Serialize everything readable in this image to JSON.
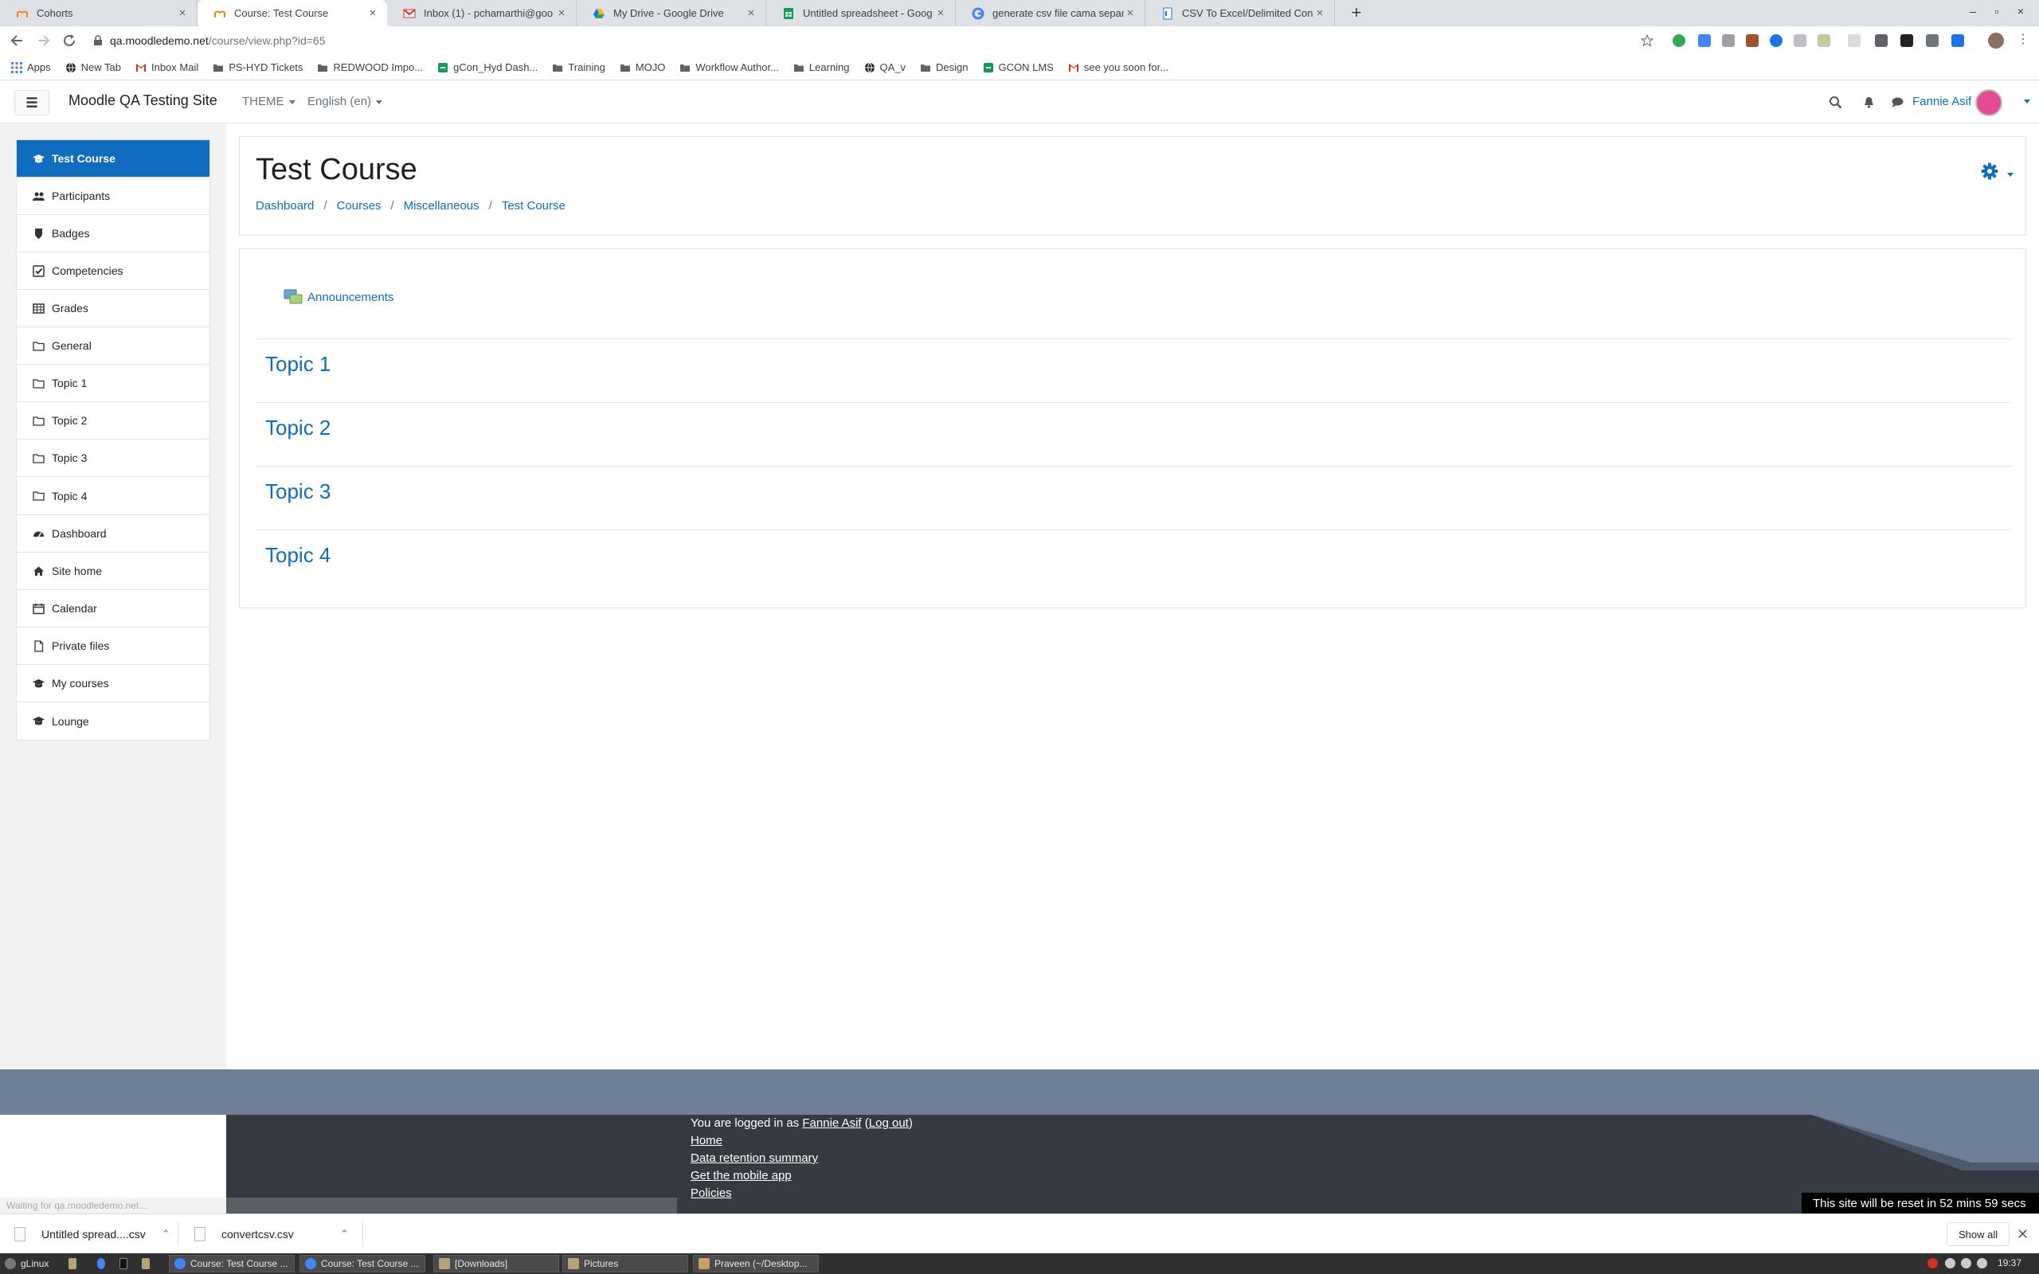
{
  "browser": {
    "tabs": [
      {
        "title": "Cohorts",
        "active": false
      },
      {
        "title": "Course: Test Course",
        "active": true
      },
      {
        "title": "Inbox (1) - pchamarthi@goo",
        "active": false
      },
      {
        "title": "My Drive - Google Drive",
        "active": false
      },
      {
        "title": "Untitled spreadsheet - Goog",
        "active": false
      },
      {
        "title": "generate csv file cama separ",
        "active": false
      },
      {
        "title": "CSV To Excel/Delimited Conv",
        "active": false
      }
    ],
    "new_tab_label": "+",
    "window_controls": [
      "–",
      "▫",
      "×"
    ],
    "url_host": "qa.moodledemo.net",
    "url_path": "/course/view.php?id=65"
  },
  "bookmarks": [
    {
      "label": "Apps",
      "icon": "apps-grid-icon"
    },
    {
      "label": "New Tab",
      "icon": "globe-icon"
    },
    {
      "label": "Inbox Mail",
      "icon": "gmail-icon"
    },
    {
      "label": "PS-HYD Tickets",
      "icon": "folder-icon"
    },
    {
      "label": "REDWOOD Impo...",
      "icon": "folder-icon"
    },
    {
      "label": "gCon_Hyd Dash...",
      "icon": "gcon-icon"
    },
    {
      "label": "Training",
      "icon": "folder-icon"
    },
    {
      "label": "MOJO",
      "icon": "folder-icon"
    },
    {
      "label": "Workflow Author...",
      "icon": "folder-icon"
    },
    {
      "label": "Learning",
      "icon": "folder-icon"
    },
    {
      "label": "QA_v",
      "icon": "globe-icon"
    },
    {
      "label": "Design",
      "icon": "folder-icon"
    },
    {
      "label": "GCON LMS",
      "icon": "gcon-icon"
    },
    {
      "label": "see you soon for...",
      "icon": "gmail-icon"
    }
  ],
  "navbar": {
    "site_name": "Moodle QA Testing Site",
    "theme_label": "THEME",
    "language_label": "English (en)",
    "user_name": "Fannie Asif"
  },
  "drawer": {
    "course_items": [
      {
        "label": "Test Course",
        "icon": "graduation-cap-icon",
        "active": true
      },
      {
        "label": "Participants",
        "icon": "users-icon"
      },
      {
        "label": "Badges",
        "icon": "badge-shield-icon"
      },
      {
        "label": "Competencies",
        "icon": "check-square-icon"
      },
      {
        "label": "Grades",
        "icon": "table-icon"
      },
      {
        "label": "General",
        "icon": "folder-icon"
      },
      {
        "label": "Topic 1",
        "icon": "folder-icon"
      },
      {
        "label": "Topic 2",
        "icon": "folder-icon"
      },
      {
        "label": "Topic 3",
        "icon": "folder-icon"
      },
      {
        "label": "Topic 4",
        "icon": "folder-icon"
      }
    ],
    "site_items": [
      {
        "label": "Dashboard",
        "icon": "dashboard-icon"
      },
      {
        "label": "Site home",
        "icon": "home-icon"
      },
      {
        "label": "Calendar",
        "icon": "calendar-icon"
      },
      {
        "label": "Private files",
        "icon": "file-icon"
      },
      {
        "label": "My courses",
        "icon": "graduation-cap-icon"
      },
      {
        "label": "Lounge",
        "icon": "graduation-cap-icon"
      }
    ]
  },
  "header": {
    "title": "Test Course",
    "breadcrumb": [
      "Dashboard",
      "Courses",
      "Miscellaneous",
      "Test Course"
    ]
  },
  "content": {
    "announcements": "Announcements",
    "topics": [
      "Topic 1",
      "Topic 2",
      "Topic 3",
      "Topic 4"
    ]
  },
  "footer": {
    "logged_in_prefix": "You are logged in as ",
    "logged_in_user": "Fannie Asif",
    "logout_label": "Log out",
    "links": [
      "Home",
      "Data retention summary",
      "Get the mobile app",
      "Policies"
    ],
    "reset_notice": "This site will be reset in 52 mins 59 secs",
    "status_text": "Waiting for qa.moodledemo.net..."
  },
  "downloads": {
    "items": [
      "Untitled spread....csv",
      "convertcsv.csv"
    ],
    "show_all": "Show all"
  },
  "taskbar": {
    "start_label": "gLinux",
    "tasks": [
      "Course: Test Course ...",
      "Course: Test Course ...",
      "[Downloads]",
      "Pictures",
      "Praveen (~/Desktop..."
    ],
    "clock": "19:37"
  },
  "colors": {
    "accent": "#0f6cbf",
    "footer_band": "#6f7f97",
    "footer_dark": "#353a40",
    "avatar": "#e34c94"
  }
}
